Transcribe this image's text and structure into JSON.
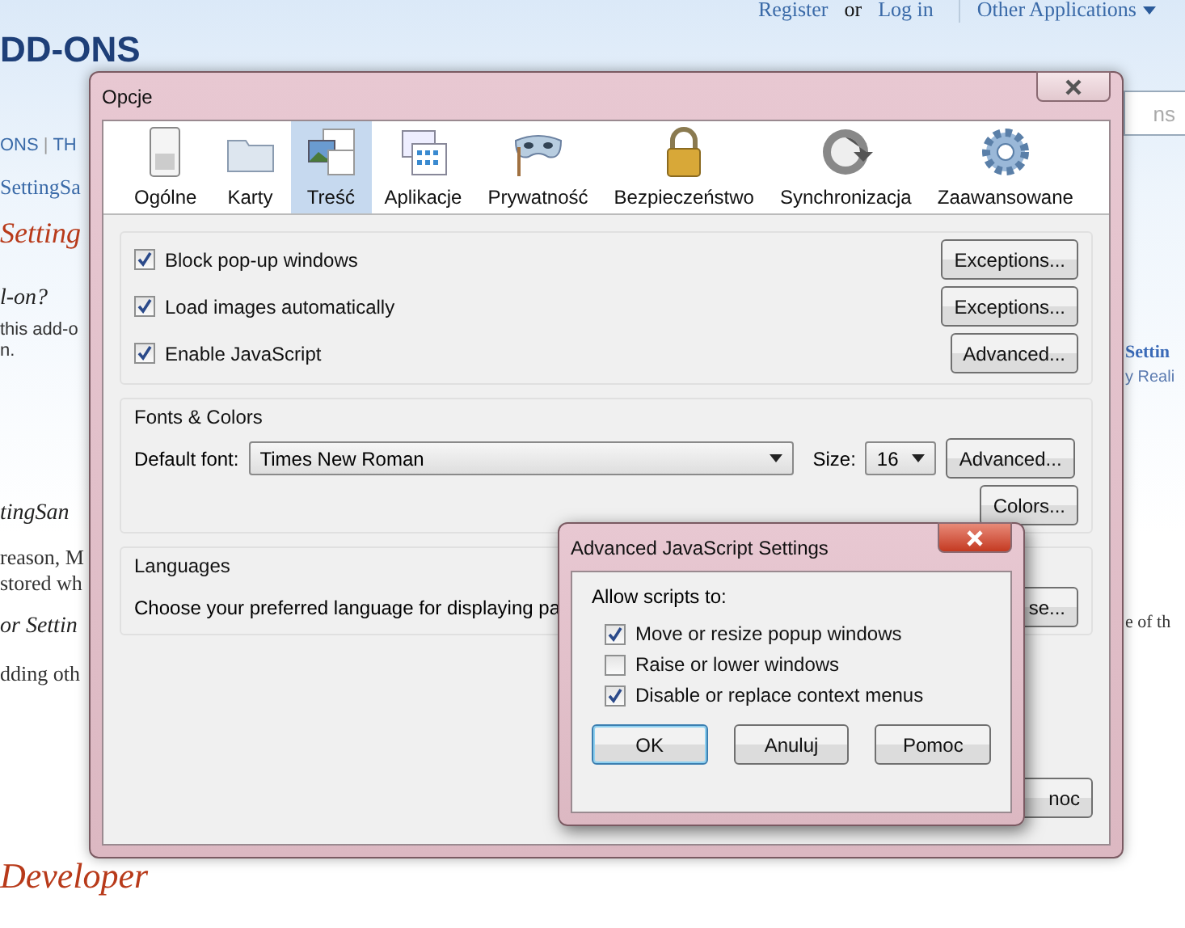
{
  "page": {
    "header_links": [
      {
        "label": "Register",
        "kind": "link"
      },
      {
        "label": "or",
        "kind": "text"
      },
      {
        "label": "Log in",
        "kind": "link"
      },
      {
        "label": "Other Applications",
        "kind": "menu"
      }
    ],
    "logo": "DD-ONS",
    "nav": [
      "ONS",
      "|",
      "TH"
    ],
    "left_fragments": [
      {
        "text": "SettingSa",
        "kind": "link"
      },
      {
        "text": "Setting",
        "kind": "heading"
      },
      {
        "text": "l-on?",
        "kind": "subheading"
      },
      {
        "text": "this add-o",
        "kind": "text"
      },
      {
        "text": "n.",
        "kind": "text"
      },
      {
        "text": "tingSan",
        "kind": "subheading"
      },
      {
        "text": "reason, M",
        "kind": "serif"
      },
      {
        "text": "stored wh",
        "kind": "serif"
      },
      {
        "text": "or Settin",
        "kind": "subheading"
      },
      {
        "text": "dding oth",
        "kind": "serif"
      },
      {
        "text": "Developer",
        "kind": "heading"
      }
    ],
    "right_fragments": [
      {
        "text": "Settin",
        "kind": "title"
      },
      {
        "text": "y Reali",
        "kind": "text"
      },
      {
        "text": "e of th",
        "kind": "serif"
      }
    ],
    "search": {
      "placeholder": "ns"
    }
  },
  "dialog": {
    "title": "Opcje",
    "tabs": [
      {
        "label": "Ogólne",
        "selected": false
      },
      {
        "label": "Karty",
        "selected": false
      },
      {
        "label": "Treść",
        "selected": true
      },
      {
        "label": "Aplikacje",
        "selected": false
      },
      {
        "label": "Prywatność",
        "selected": false
      },
      {
        "label": "Bezpieczeństwo",
        "selected": false
      },
      {
        "label": "Synchronizacja",
        "selected": false
      },
      {
        "label": "Zaawansowane",
        "selected": false
      }
    ],
    "options": [
      {
        "label": "Block pop-up windows",
        "checked": true,
        "button": "Exceptions..."
      },
      {
        "label": "Load images automatically",
        "checked": true,
        "button": "Exceptions..."
      },
      {
        "label": "Enable JavaScript",
        "checked": true,
        "button": "Advanced..."
      }
    ],
    "fonts": {
      "title": "Fonts & Colors",
      "font_label": "Default font:",
      "font_value": "Times New Roman",
      "size_label": "Size:",
      "size_value": "16",
      "advanced_button": "Advanced...",
      "colors_button": "Colors..."
    },
    "languages": {
      "title": "Languages",
      "text": "Choose your preferred language for displaying pa",
      "button": "se..."
    },
    "footer_button": "noc"
  },
  "subdialog": {
    "title": "Advanced JavaScript Settings",
    "prompt": "Allow scripts to:",
    "options": [
      {
        "label": "Move or resize popup windows",
        "checked": true
      },
      {
        "label": "Raise or lower windows",
        "checked": false
      },
      {
        "label": "Disable or replace context menus",
        "checked": true
      }
    ],
    "buttons": [
      {
        "label": "OK",
        "default": true
      },
      {
        "label": "Anuluj",
        "default": false
      },
      {
        "label": "Pomoc",
        "default": false
      }
    ]
  }
}
